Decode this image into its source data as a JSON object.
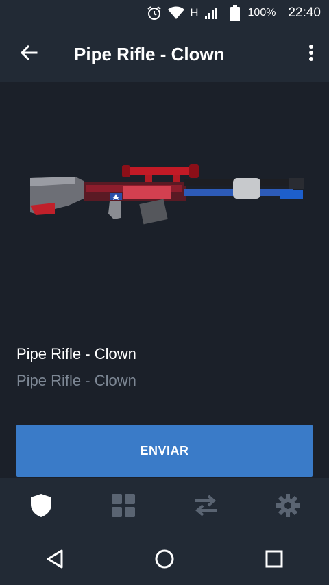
{
  "status_bar": {
    "network": "H",
    "battery": "100%",
    "time": "22:40"
  },
  "app_bar": {
    "title": "Pipe Rifle - Clown",
    "back_icon": "arrow-left-icon",
    "menu_icon": "more-vert-icon"
  },
  "item": {
    "name": "Pipe Rifle - Clown",
    "subtitle": "Pipe Rifle - Clown"
  },
  "actions": {
    "send_label": "ENVIAR"
  },
  "tabs": [
    {
      "icon": "shield-icon",
      "active": true
    },
    {
      "icon": "grid-icon",
      "active": false
    },
    {
      "icon": "transfer-icon",
      "active": false
    },
    {
      "icon": "gear-icon",
      "active": false
    }
  ],
  "colors": {
    "background": "#1b2029",
    "bar": "#222a35",
    "accent": "#3a7bc8",
    "subtle_text": "#7d8794"
  }
}
